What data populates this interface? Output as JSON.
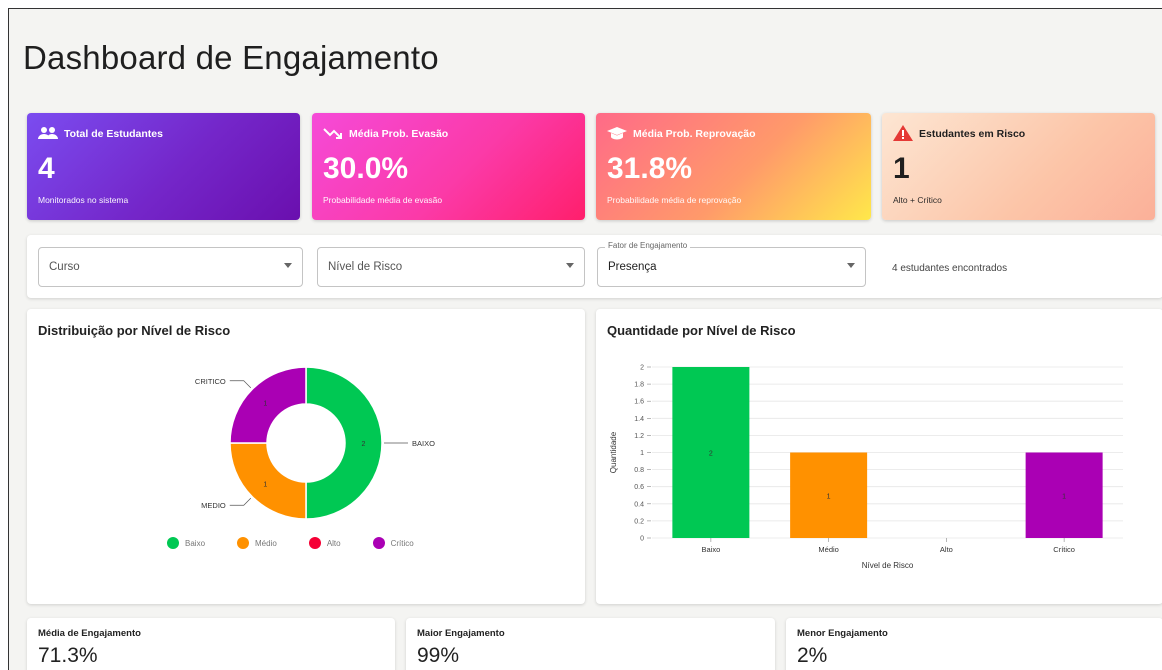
{
  "header": {
    "title": "Dashboard de Engajamento"
  },
  "kpis": [
    {
      "icon": "people-icon",
      "label": "Total de Estudantes",
      "value": "4",
      "sub": "Monitorados no sistema"
    },
    {
      "icon": "trending-down-icon",
      "label": "Média Prob. Evasão",
      "value": "30.0%",
      "sub": "Probabilidade média de evasão"
    },
    {
      "icon": "graduation-cap-icon",
      "label": "Média Prob. Reprovação",
      "value": "31.8%",
      "sub": "Probabilidade média de reprovação"
    },
    {
      "icon": "warning-icon",
      "label": "Estudantes em Risco",
      "value": "1",
      "sub": "Alto + Crítico"
    }
  ],
  "filters": {
    "curso": {
      "placeholder": "Curso"
    },
    "nivel": {
      "placeholder": "Nível de Risco"
    },
    "fator": {
      "label": "Fator de Engajamento",
      "value": "Presença"
    },
    "count_text": "4 estudantes encontrados"
  },
  "pie_card": {
    "title": "Distribuição por Nível de Risco",
    "legend": [
      {
        "name": "Baixo",
        "color": "#00c853"
      },
      {
        "name": "Médio",
        "color": "#ff9100"
      },
      {
        "name": "Alto",
        "color": "#f50035"
      },
      {
        "name": "Crítico",
        "color": "#aa00b4"
      }
    ]
  },
  "bar_card": {
    "title": "Quantidade por Nível de Risco"
  },
  "chart_data": [
    {
      "type": "pie",
      "title": "Distribuição por Nível de Risco",
      "categories": [
        "BAIXO",
        "MEDIO",
        "CRITICO"
      ],
      "values": [
        2,
        1,
        1
      ],
      "colors": [
        "#00c853",
        "#ff9100",
        "#aa00b4"
      ],
      "value_labels": [
        "2",
        "1",
        "1"
      ],
      "donut": true,
      "legend": [
        "Baixo",
        "Médio",
        "Alto",
        "Crítico"
      ]
    },
    {
      "type": "bar",
      "title": "Quantidade por Nível de Risco",
      "categories": [
        "Baixo",
        "Médio",
        "Alto",
        "Crítico"
      ],
      "values": [
        2,
        1,
        0,
        1
      ],
      "value_labels": [
        "2",
        "1",
        "",
        "1"
      ],
      "colors": [
        "#00c853",
        "#ff9100",
        "#f50035",
        "#aa00b4"
      ],
      "xlabel": "Nível de Risco",
      "ylabel": "Quantidade",
      "ylim": [
        0,
        2
      ],
      "yticks": [
        "0",
        "0.2",
        "0.4",
        "0.6",
        "0.8",
        "1",
        "1.2",
        "1.4",
        "1.6",
        "1.8",
        "2"
      ],
      "grid": true
    }
  ],
  "stats": [
    {
      "label": "Média de Engajamento",
      "value": "71.3%"
    },
    {
      "label": "Maior Engajamento",
      "value": "99%"
    },
    {
      "label": "Menor Engajamento",
      "value": "2%"
    }
  ]
}
